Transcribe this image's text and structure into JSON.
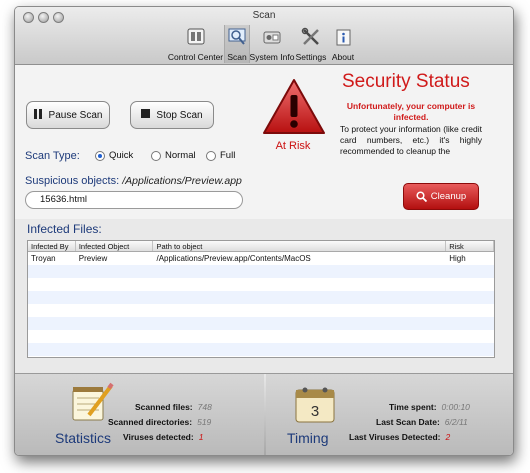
{
  "window": {
    "title": "Scan",
    "toolbar": [
      {
        "label": "Control Center",
        "icon": "control-center-icon"
      },
      {
        "label": "Scan",
        "icon": "scan-icon",
        "active": true
      },
      {
        "label": "System Info",
        "icon": "system-info-icon"
      },
      {
        "label": "Settings",
        "icon": "settings-icon"
      },
      {
        "label": "About",
        "icon": "about-icon"
      }
    ]
  },
  "controls": {
    "pause_label": "Pause Scan",
    "stop_label": "Stop Scan",
    "scan_type_label": "Scan Type:",
    "scan_types": [
      "Quick",
      "Normal",
      "Full"
    ],
    "scan_type_selected": "Quick"
  },
  "suspicious": {
    "label": "Suspicious objects:",
    "path": "/Applications/Preview.app",
    "current_file": "15636.html"
  },
  "status": {
    "title": "Security Status",
    "warning": "Unfortunately, your computer is infected.",
    "body": "To protect your information (like credit card numbers, etc.) it's highly recommended to cleanup the",
    "risk_label": "At Risk",
    "cleanup_label": "Cleanup"
  },
  "infected": {
    "label": "Infected Files:",
    "columns": [
      "Infected By",
      "Infected Object",
      "Path to object",
      "Risk"
    ],
    "rows": [
      [
        "Troyan",
        "Preview",
        "/Applications/Preview.app/Contents/MacOS",
        "High"
      ]
    ]
  },
  "statistics": {
    "title": "Statistics",
    "items": [
      {
        "label": "Scanned files:",
        "value": "748"
      },
      {
        "label": "Scanned directories:",
        "value": "519"
      },
      {
        "label": "Viruses detected:",
        "value": "1"
      }
    ]
  },
  "timing": {
    "title": "Timing",
    "calendar_day": "3",
    "items": [
      {
        "label": "Time spent:",
        "value": "0:00:10"
      },
      {
        "label": "Last Scan Date:",
        "value": "6/2/11"
      },
      {
        "label": "Last Viruses Detected:",
        "value": "2"
      }
    ]
  },
  "colors": {
    "accent_blue": "#1d3a7a",
    "alert_red": "#d01a1a",
    "row_stripe": "#edf3fe"
  }
}
